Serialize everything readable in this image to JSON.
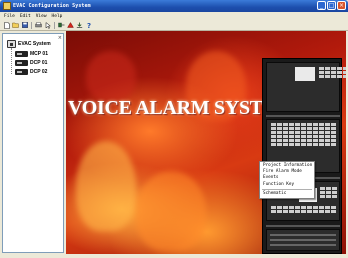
{
  "window": {
    "title": "EVAC Configuration System"
  },
  "menubar": {
    "items": [
      "File",
      "Edit",
      "View",
      "Help"
    ]
  },
  "toolbar": {
    "buttons": [
      "new-icon",
      "open-icon",
      "save-icon",
      "print-icon",
      "pointer-icon",
      "connect-icon",
      "alarm-icon",
      "download-icon",
      "help-icon"
    ]
  },
  "sidebar": {
    "root_label": "EVAC System",
    "children": [
      "MCP 01",
      "DCP 01",
      "DCP 02"
    ]
  },
  "main": {
    "headline": "VOICE ALARM SYSTEM"
  },
  "context_menu": {
    "items": [
      "Project Information",
      "Fire Alarm Mode",
      "Events",
      "Function Key",
      "Schematic"
    ]
  },
  "colors": {
    "titlebar": "#1d4fae",
    "background_red": "#b21a0c",
    "flame_orange": "#ff7a2a"
  }
}
